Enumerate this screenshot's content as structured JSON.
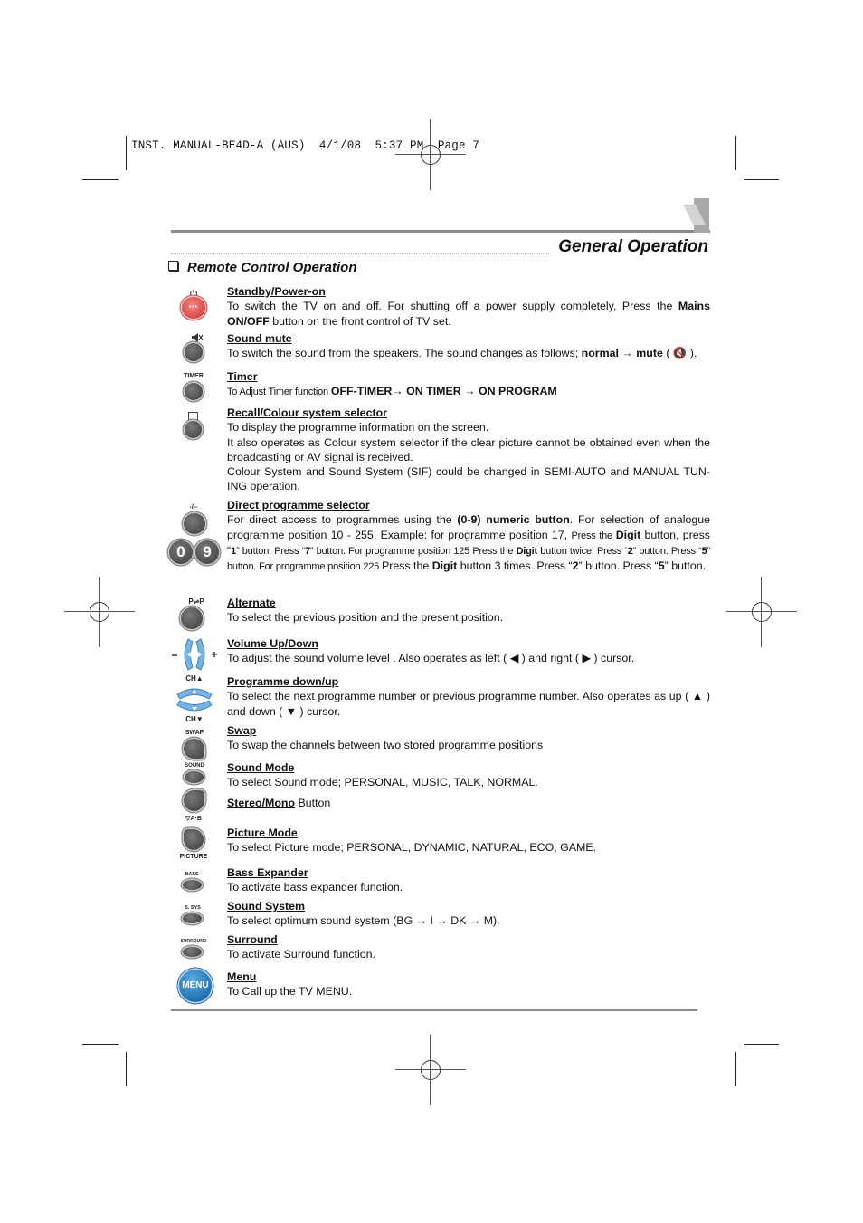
{
  "slug_line": "INST. MANUAL-BE4D-A (AUS)  4/1/08  5:37 PM  Page 7",
  "header": {
    "section_title": "General Operation",
    "subsection_title": "Remote Control Operation"
  },
  "icons": {
    "timer_label": "TIMER",
    "digit_label": "-/--",
    "num_0": "0",
    "num_9": "9",
    "alternate_label": "P⇌P",
    "ch_up_label": "CH▲",
    "ch_down_label": "CH▼",
    "swap_label": "SWAP",
    "sound_label": "SOUND",
    "ab_label": "▽A·B",
    "picture_label": "PICTURE",
    "bass_label": "BASS",
    "ssys_label": "S. SYS",
    "surround_label": "SURROUND",
    "menu_label": "MENU",
    "power_dots": "•••",
    "vol_minus": "−",
    "vol_plus": "+"
  },
  "entries": {
    "standby": {
      "title": "Standby/Power-on",
      "desc_a": "To switch the TV on and off. For shutting off a power supply completely, Press the ",
      "desc_b": "Mains ON/OFF",
      "desc_c": " button on the front control of TV set."
    },
    "mute": {
      "title": "Sound mute",
      "desc_a": "To switch the sound from the speakers. The sound changes as follows; ",
      "desc_b": "normal → mute",
      "desc_c": " ( 🔇 )."
    },
    "timer": {
      "title": "Timer",
      "desc_a": "To Adjust Timer function  ",
      "desc_b": "OFF-TIMER→ ON TIMER → ON PROGRAM"
    },
    "recall": {
      "title": "Recall/Colour system selector",
      "line1": "To display the programme information on the screen.",
      "line2": "It also operates as Colour system selector if the clear picture cannot be obtained even when the broadcasting or AV signal is received.",
      "line3": "Colour System and Sound System (SIF) could be changed in SEMI-AUTO and MANUAL TUN-ING operation."
    },
    "direct": {
      "title": "Direct programme selector",
      "p1": "For direct access to programmes using the ",
      "p2": "(0-9) numeric button",
      "p3": ". For selection of analogue programme position 10 - 255, Example: for programme position  17, ",
      "p4": "Press the ",
      "p5": "Digit",
      "p6": "  button, press “",
      "p7": "1",
      "p8": "” button. Press “",
      "p9": "7",
      "p10": "”  button. For programme position 125 Press the ",
      "p11": "Digit",
      "p12": " button twice. Press “",
      "p13": "2",
      "p14": "” button. Press “",
      "p15": "5",
      "p16": "” button. For programme position 225 ",
      "p17": "Press the ",
      "p18": "Digit",
      "p19": "  button 3 times. Press “",
      "p20": "2",
      "p21": "” button. Press “",
      "p22": "5",
      "p23": "” button."
    },
    "alternate": {
      "title": "Alternate",
      "desc": "To select the previous position and the present position."
    },
    "volume": {
      "title": "Volume Up/Down",
      "desc": "To adjust the sound volume level . Also operates as left  ( ◀ ) and right ( ▶ ) cursor."
    },
    "programme": {
      "title": "Programme down/up",
      "desc": "To select the next programme number or previous programme number. Also operates as up ( ▲ ) and down ( ▼ ) cursor."
    },
    "swap": {
      "title": "Swap",
      "desc": "To swap the channels between two stored programme positions"
    },
    "sound_mode": {
      "title": "Sound Mode",
      "desc": "To select Sound  mode; PERSONAL, MUSIC, TALK, NORMAL."
    },
    "stereo": {
      "title": "Stereo/Mono",
      "suffix": " Button"
    },
    "picture": {
      "title": "Picture Mode",
      "desc": "To select Picture  mode; PERSONAL, DYNAMIC, NATURAL, ECO, GAME."
    },
    "bass": {
      "title": "Bass Expander",
      "desc": "To activate bass expander function."
    },
    "sound_system": {
      "title": "Sound System",
      "desc": "To select optimum sound system (BG → I → DK → M)."
    },
    "surround": {
      "title": "Surround",
      "desc": "To activate Surround function."
    },
    "menu": {
      "title": "Menu",
      "desc": "To Call up the TV MENU."
    }
  }
}
